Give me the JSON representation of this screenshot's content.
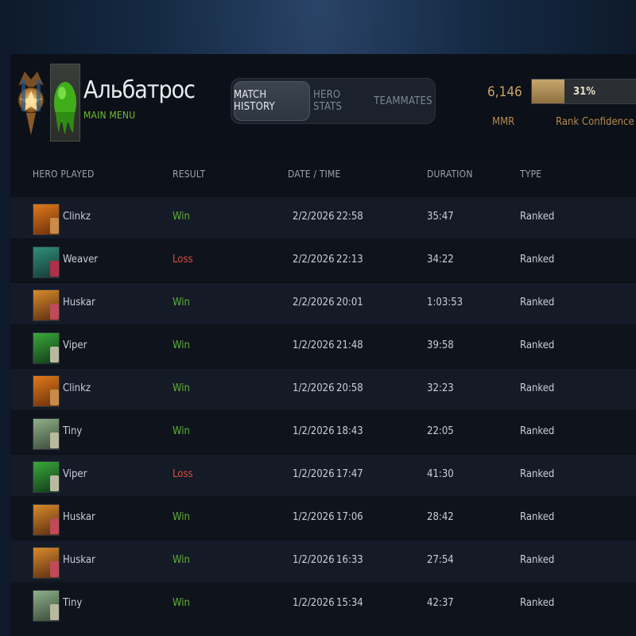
{
  "player": {
    "name": "Альбатрос",
    "subtitle": "MAIN MENU"
  },
  "tabs": [
    {
      "label": "MATCH HISTORY",
      "active": true
    },
    {
      "label": "HERO STATS",
      "active": false
    },
    {
      "label": "TEAMMATES",
      "active": false
    }
  ],
  "stats": {
    "mmr_value": "6,146",
    "mmr_label": "MMR",
    "rank_confidence_text": "31%",
    "rank_confidence_fraction": 0.31,
    "rank_confidence_label": "Rank Confidence"
  },
  "columns": {
    "hero": "HERO PLAYED",
    "result": "RESULT",
    "datetime": "DATE / TIME",
    "duration": "DURATION",
    "type": "TYPE"
  },
  "colors": {
    "win": "#5fb03a",
    "loss": "#d64e3a",
    "accent_gold": "#caa465",
    "menu_green": "#6fbf2f"
  },
  "matches": [
    {
      "hero": "Clinkz",
      "result": "Win",
      "date": "2/2/2026",
      "time": "22:58",
      "duration": "35:47",
      "type": "Ranked"
    },
    {
      "hero": "Weaver",
      "result": "Loss",
      "date": "2/2/2026",
      "time": "22:13",
      "duration": "34:22",
      "type": "Ranked"
    },
    {
      "hero": "Huskar",
      "result": "Win",
      "date": "2/2/2026",
      "time": "20:01",
      "duration": "1:03:53",
      "type": "Ranked"
    },
    {
      "hero": "Viper",
      "result": "Win",
      "date": "1/2/2026",
      "time": "21:48",
      "duration": "39:58",
      "type": "Ranked"
    },
    {
      "hero": "Clinkz",
      "result": "Win",
      "date": "1/2/2026",
      "time": "20:58",
      "duration": "32:23",
      "type": "Ranked"
    },
    {
      "hero": "Tiny",
      "result": "Win",
      "date": "1/2/2026",
      "time": "18:43",
      "duration": "22:05",
      "type": "Ranked"
    },
    {
      "hero": "Viper",
      "result": "Loss",
      "date": "1/2/2026",
      "time": "17:47",
      "duration": "41:30",
      "type": "Ranked"
    },
    {
      "hero": "Huskar",
      "result": "Win",
      "date": "1/2/2026",
      "time": "17:06",
      "duration": "28:42",
      "type": "Ranked"
    },
    {
      "hero": "Huskar",
      "result": "Win",
      "date": "1/2/2026",
      "time": "16:33",
      "duration": "27:54",
      "type": "Ranked"
    },
    {
      "hero": "Tiny",
      "result": "Win",
      "date": "1/2/2026",
      "time": "15:34",
      "duration": "42:37",
      "type": "Ranked"
    }
  ]
}
